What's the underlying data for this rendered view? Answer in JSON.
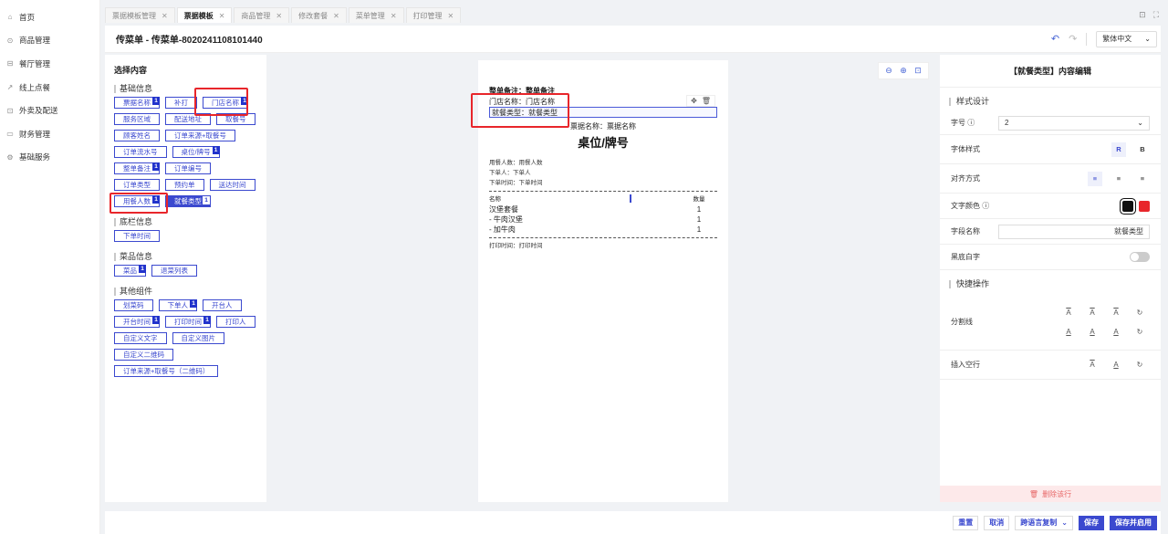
{
  "nav": [
    {
      "label": "首页",
      "icon": "home-icon",
      "glyph": "⌂"
    },
    {
      "label": "商品管理",
      "icon": "goods-icon",
      "glyph": "⊙"
    },
    {
      "label": "餐厅管理",
      "icon": "restaurant-icon",
      "glyph": "⊟"
    },
    {
      "label": "线上点餐",
      "icon": "online-order-icon",
      "glyph": "↗"
    },
    {
      "label": "外卖及配送",
      "icon": "delivery-icon",
      "glyph": "⊡"
    },
    {
      "label": "财务管理",
      "icon": "finance-icon",
      "glyph": "▭"
    },
    {
      "label": "基础服务",
      "icon": "settings-icon",
      "glyph": "⚙"
    }
  ],
  "tabs": [
    {
      "label": "票据模板管理",
      "active": false
    },
    {
      "label": "票据模板",
      "active": true
    },
    {
      "label": "商品管理",
      "active": false
    },
    {
      "label": "修改套餐",
      "active": false
    },
    {
      "label": "菜单管理",
      "active": false
    },
    {
      "label": "打印管理",
      "active": false
    }
  ],
  "header": {
    "title": "传菜单 - 传菜单-8020241108101440",
    "language": "繁体中文"
  },
  "left": {
    "heading": "选择内容",
    "sections": [
      {
        "title": "基础信息",
        "chips": [
          {
            "label": "票据名称",
            "badge": "1"
          },
          {
            "label": "补打",
            "badge": ""
          },
          {
            "label": "门店名称",
            "badge": "1"
          },
          {
            "label": "服务区域",
            "badge": ""
          },
          {
            "label": "配送地址",
            "badge": ""
          },
          {
            "label": "取餐号",
            "badge": ""
          },
          {
            "label": "顾客姓名",
            "badge": ""
          },
          {
            "label": "订单来源+取餐号",
            "badge": ""
          },
          {
            "label": "订单流水号",
            "badge": ""
          },
          {
            "label": "桌位/牌号",
            "badge": "1"
          },
          {
            "label": "整单备注",
            "badge": "1"
          },
          {
            "label": "订单编号",
            "badge": ""
          },
          {
            "label": "订单类型",
            "badge": ""
          },
          {
            "label": "预约单",
            "badge": ""
          },
          {
            "label": "送达时间",
            "badge": ""
          },
          {
            "label": "用餐人数",
            "badge": "1"
          },
          {
            "label": "就餐类型",
            "badge": "1",
            "filled": true
          }
        ]
      },
      {
        "title": "底栏信息",
        "chips": [
          {
            "label": "下单时间",
            "badge": ""
          }
        ]
      },
      {
        "title": "菜品信息",
        "chips": [
          {
            "label": "菜品",
            "badge": "1"
          },
          {
            "label": "退菜列表",
            "badge": ""
          }
        ]
      },
      {
        "title": "其他组件",
        "chips": [
          {
            "label": "划菜码",
            "badge": ""
          },
          {
            "label": "下单人",
            "badge": "1"
          },
          {
            "label": "开台人",
            "badge": ""
          },
          {
            "label": "开台时间",
            "badge": "1"
          },
          {
            "label": "打印时间",
            "badge": "1"
          },
          {
            "label": "打印人",
            "badge": ""
          },
          {
            "label": "自定义文字",
            "badge": ""
          },
          {
            "label": "自定义图片",
            "badge": ""
          },
          {
            "label": "自定义二维码",
            "badge": ""
          },
          {
            "label": "订单来源+取餐号（二维码）",
            "badge": ""
          }
        ]
      }
    ]
  },
  "receipt": {
    "remark": "整单备注：整单备注",
    "store": "门店名称：门店名称",
    "dining_type": "就餐类型：就餐类型",
    "bill_name": "票据名称：票据名称",
    "table_no": "桌位/牌号",
    "guests": "用餐人数：用餐人数",
    "orderer": "下单人：下单人",
    "order_time": "下单时间：下单时间",
    "col_name": "名称",
    "col_qty": "数量",
    "items": [
      {
        "name": "汉堡套餐",
        "qty": "1"
      },
      {
        "name": "- 牛肉汉堡",
        "qty": "1"
      },
      {
        "name": "- 加牛肉",
        "qty": "1"
      }
    ],
    "print_time": "打印时间：打印时间"
  },
  "right": {
    "title": "【就餐类型】内容编辑",
    "style_section": "样式设计",
    "font_size_label": "字号",
    "font_size_value": "2",
    "font_style_label": "字体样式",
    "align_label": "对齐方式",
    "color_label": "文字颜色",
    "field_name_label": "字段名称",
    "field_name_value": "就餐类型",
    "invert_label": "黑底白字",
    "quick_section": "快捷操作",
    "divider_label": "分割线",
    "insert_blank_label": "插入空行",
    "delete_row": "删除该行",
    "colors": [
      "#111111",
      "#e8262b"
    ]
  },
  "footer": {
    "reset": "重置",
    "cancel": "取消",
    "cross_lang": "跨语言复制",
    "save": "保存",
    "save_enable": "保存并启用"
  }
}
